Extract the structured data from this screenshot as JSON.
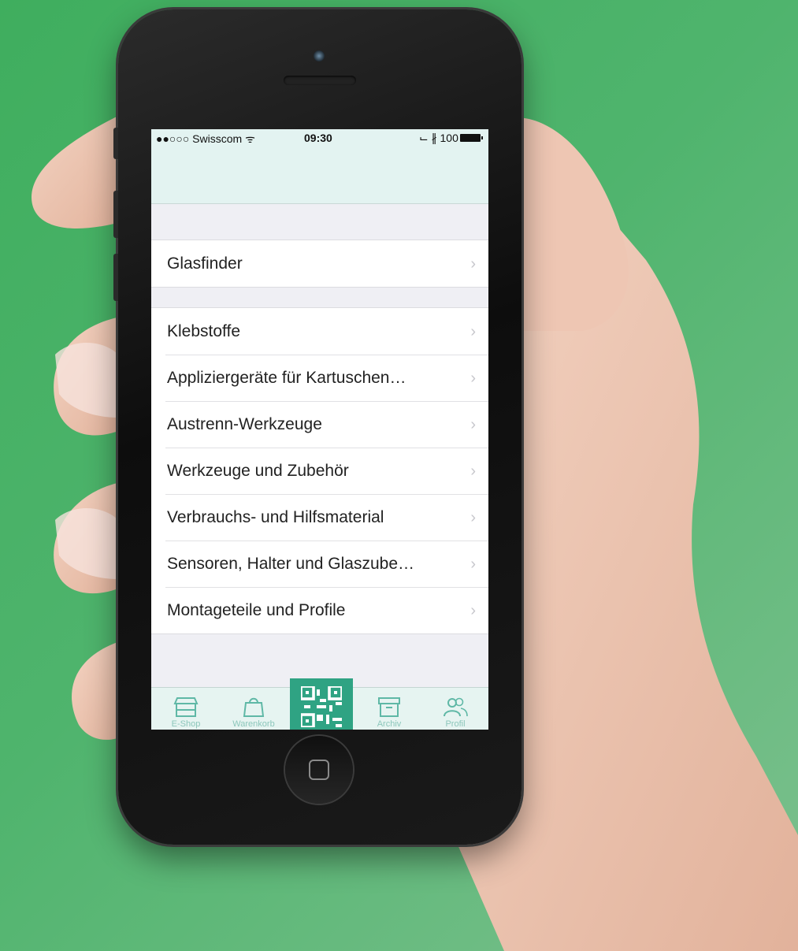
{
  "status_bar": {
    "carrier": "●●○○○ Swisscom ᯤ",
    "time": "09:30",
    "battery": "⌙ ∦ 100 %"
  },
  "menu": {
    "top_items": [
      {
        "label": "Glasfinder"
      }
    ],
    "items": [
      {
        "label": "Klebstoffe"
      },
      {
        "label": "Appliziergeräte für Kartuschen…"
      },
      {
        "label": "Austrenn-Werkzeuge"
      },
      {
        "label": "Werkzeuge und Zubehör"
      },
      {
        "label": "Verbrauchs- und Hilfsmaterial"
      },
      {
        "label": "Sensoren, Halter und Glaszube…"
      },
      {
        "label": "Montageteile und Profile"
      }
    ],
    "chevron": "›"
  },
  "tab_bar": {
    "tabs": [
      {
        "label": "E-Shop",
        "icon": "store-icon"
      },
      {
        "label": "Warenkorb",
        "icon": "shopping-bag-icon"
      },
      {
        "label": "",
        "icon": "qr-code-icon"
      },
      {
        "label": "Archiv",
        "icon": "archive-box-icon"
      },
      {
        "label": "Profil",
        "icon": "users-icon"
      }
    ],
    "active_color": "#2fa383",
    "tint_color": "#5fb8a6"
  },
  "colors": {
    "background": "#4fb46d",
    "nav_tint": "#e3f3f1"
  }
}
